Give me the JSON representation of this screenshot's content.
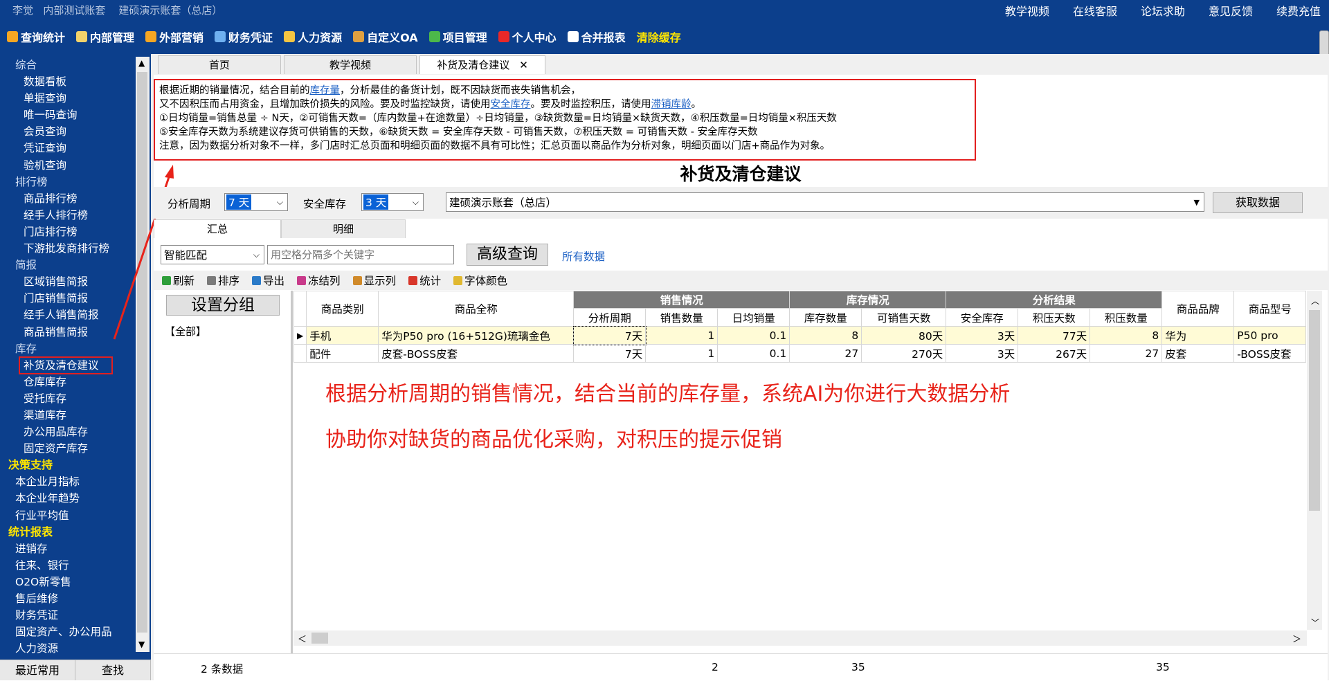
{
  "topbar": {
    "user": "李觉",
    "account_type": "内部测试账套",
    "company": "建硕演示账套（总店）",
    "links": [
      {
        "label": "教学视频",
        "color": "#e8231a"
      },
      {
        "label": "在线客服",
        "color": "#f5a623"
      },
      {
        "label": "论坛求助",
        "color": "#e85cc0"
      },
      {
        "label": "意见反馈",
        "color": "#f0e040"
      },
      {
        "label": "续费充值",
        "color": "#54c04a"
      }
    ]
  },
  "menu": [
    {
      "label": "查询统计",
      "icon": "bar-chart-icon",
      "color": "#f5a623"
    },
    {
      "label": "内部管理",
      "icon": "hand-icon",
      "color": "#f3d36b"
    },
    {
      "label": "外部营销",
      "icon": "gift-icon",
      "color": "#f5a623"
    },
    {
      "label": "财务凭证",
      "icon": "document-icon",
      "color": "#6fb0f0"
    },
    {
      "label": "人力资源",
      "icon": "person-icon",
      "color": "#f5c542"
    },
    {
      "label": "自定义OA",
      "icon": "tools-icon",
      "color": "#e0a040"
    },
    {
      "label": "项目管理",
      "icon": "circle-check-icon",
      "color": "#4cb84a"
    },
    {
      "label": "个人中心",
      "icon": "heart-icon",
      "color": "#e82828"
    },
    {
      "label": "合并报表",
      "icon": "file-icon",
      "color": "#ffffff"
    },
    {
      "label": "清除缓存",
      "icon": "",
      "color": ""
    }
  ],
  "sidebar": {
    "items": [
      {
        "label": "综合",
        "level": "0"
      },
      {
        "label": "数据看板",
        "level": "1"
      },
      {
        "label": "单据查询",
        "level": "1"
      },
      {
        "label": "唯一码查询",
        "level": "1"
      },
      {
        "label": "会员查询",
        "level": "1"
      },
      {
        "label": "凭证查询",
        "level": "1"
      },
      {
        "label": "验机查询",
        "level": "1"
      },
      {
        "label": "排行榜",
        "level": "0"
      },
      {
        "label": "商品排行榜",
        "level": "1"
      },
      {
        "label": "经手人排行榜",
        "level": "1"
      },
      {
        "label": "门店排行榜",
        "level": "1"
      },
      {
        "label": "下游批发商排行榜",
        "level": "1"
      },
      {
        "label": "简报",
        "level": "0"
      },
      {
        "label": "区域销售简报",
        "level": "1"
      },
      {
        "label": "门店销售简报",
        "level": "1"
      },
      {
        "label": "经手人销售简报",
        "level": "1"
      },
      {
        "label": "商品销售简报",
        "level": "1"
      },
      {
        "label": "库存",
        "level": "0"
      },
      {
        "label": "补货及清仓建议",
        "level": "sel"
      },
      {
        "label": "仓库库存",
        "level": "1"
      },
      {
        "label": "受托库存",
        "level": "1"
      },
      {
        "label": "渠道库存",
        "level": "1"
      },
      {
        "label": "办公用品库存",
        "level": "1"
      },
      {
        "label": "固定资产库存",
        "level": "1"
      },
      {
        "label": "决策支持",
        "level": "0b"
      },
      {
        "label": "本企业月指标",
        "level": "1b"
      },
      {
        "label": "本企业年趋势",
        "level": "1b"
      },
      {
        "label": "行业平均值",
        "level": "1b"
      },
      {
        "label": "统计报表",
        "level": "0b"
      },
      {
        "label": "进销存",
        "level": "1b"
      },
      {
        "label": "往来、银行",
        "level": "1b"
      },
      {
        "label": "O2O新零售",
        "level": "1b"
      },
      {
        "label": "售后维修",
        "level": "1b"
      },
      {
        "label": "财务凭证",
        "level": "1b"
      },
      {
        "label": "固定资产、办公用品",
        "level": "1b"
      },
      {
        "label": "人力资源",
        "level": "1b"
      }
    ],
    "bottom_left": "最近常用",
    "bottom_right": "查找"
  },
  "tabs": [
    {
      "label": "首页",
      "active": false
    },
    {
      "label": "教学视频",
      "active": false
    },
    {
      "label": "补货及清仓建议",
      "active": true
    }
  ],
  "tab_close": "✕",
  "notice": {
    "l1a": "根据近期的销量情况，结合目前的",
    "l1link": "库存量",
    "l1b": "，分析最佳的备货计划，既不因缺货而丧失销售机会，",
    "l2a": "又不因积压而占用资金，且增加跌价损失的风险。要及时监控缺货，请使用",
    "l2link1": "安全库存",
    "l2b": "。要及时监控积压，请使用",
    "l2link2": "滞销库龄",
    "l2c": "。",
    "l3": "①日均销量=销售总量 ÷ N天，②可销售天数=（库内数量+在途数量）÷日均销量，③缺货数量=日均销量×缺货天数，④积压数量=日均销量×积压天数",
    "l4": "⑤安全库存天数为系统建议存货可供销售的天数，⑥缺货天数 = 安全库存天数 - 可销售天数，⑦积压天数 = 可销售天数 - 安全库存天数",
    "l5": "注意，因为数据分析对象不一样，多门店时汇总页面和明细页面的数据不具有可比性；汇总页面以商品作为分析对象，明细页面以门店+商品作为对象。"
  },
  "page_title": "补货及清仓建议",
  "filters": {
    "period_label": "分析周期",
    "period_value": "7 天",
    "safety_label": "安全库存",
    "safety_value": "3 天",
    "store_value": "建硕演示账套（总店）",
    "fetch_button": "获取数据"
  },
  "subtabs": [
    {
      "label": "汇总",
      "active": true
    },
    {
      "label": "明细",
      "active": false
    }
  ],
  "search": {
    "match_value": "智能匹配",
    "placeholder": "用空格分隔多个关键字",
    "advanced_button": "高级查询",
    "all_data_link": "所有数据"
  },
  "toolbar": [
    {
      "label": "刷新",
      "icon": "refresh-icon",
      "color": "#2e9e3a"
    },
    {
      "label": "排序",
      "icon": "sort-icon",
      "color": "#7a7a7a"
    },
    {
      "label": "导出",
      "icon": "export-icon",
      "color": "#2a7ac8"
    },
    {
      "label": "冻结列",
      "icon": "freeze-columns-icon",
      "color": "#c83a8a"
    },
    {
      "label": "显示列",
      "icon": "show-columns-icon",
      "color": "#d08a2a"
    },
    {
      "label": "统计",
      "icon": "statistics-icon",
      "color": "#d8362a"
    },
    {
      "label": "字体颜色",
      "icon": "font-color-icon",
      "color": "#e0b830"
    }
  ],
  "group_panel": {
    "button": "设置分组",
    "all": "【全部】"
  },
  "grid": {
    "group_headers": {
      "sales": "销售情况",
      "stock": "库存情况",
      "analysis": "分析结果"
    },
    "col_category": "商品类别",
    "col_name": "商品全称",
    "col_period": "分析周期",
    "col_qty": "销售数量",
    "col_daily": "日均销量",
    "col_stock": "库存数量",
    "col_days": "可销售天数",
    "col_safety": "安全库存",
    "col_overstock_days": "积压天数",
    "col_overstock_qty": "积压数量",
    "col_brand": "商品品牌",
    "col_model": "商品型号",
    "rows": [
      {
        "category": "手机",
        "name": "华为P50 pro (16+512G)琉璃金色",
        "period": "7天",
        "qty": "1",
        "daily": "0.1",
        "stock": "8",
        "days": "80天",
        "safety": "3天",
        "od": "77天",
        "oq": "8",
        "brand": "华为",
        "model": "P50 pro"
      },
      {
        "category": "配件",
        "name": "皮套-BOSS皮套",
        "period": "7天",
        "qty": "1",
        "daily": "0.1",
        "stock": "27",
        "days": "270天",
        "safety": "3天",
        "od": "267天",
        "oq": "27",
        "brand": "皮套",
        "model": "-BOSS皮套"
      }
    ]
  },
  "annotations": {
    "line1": "根据分析周期的销售情况，结合当前的库存量，系统AI为你进行大数据分析",
    "line2": "协助你对缺货的商品优化采购，对积压的提示促销"
  },
  "footer": {
    "count": "2 条数据",
    "qty_total": "2",
    "stock_total": "35",
    "overstock_total": "35"
  }
}
